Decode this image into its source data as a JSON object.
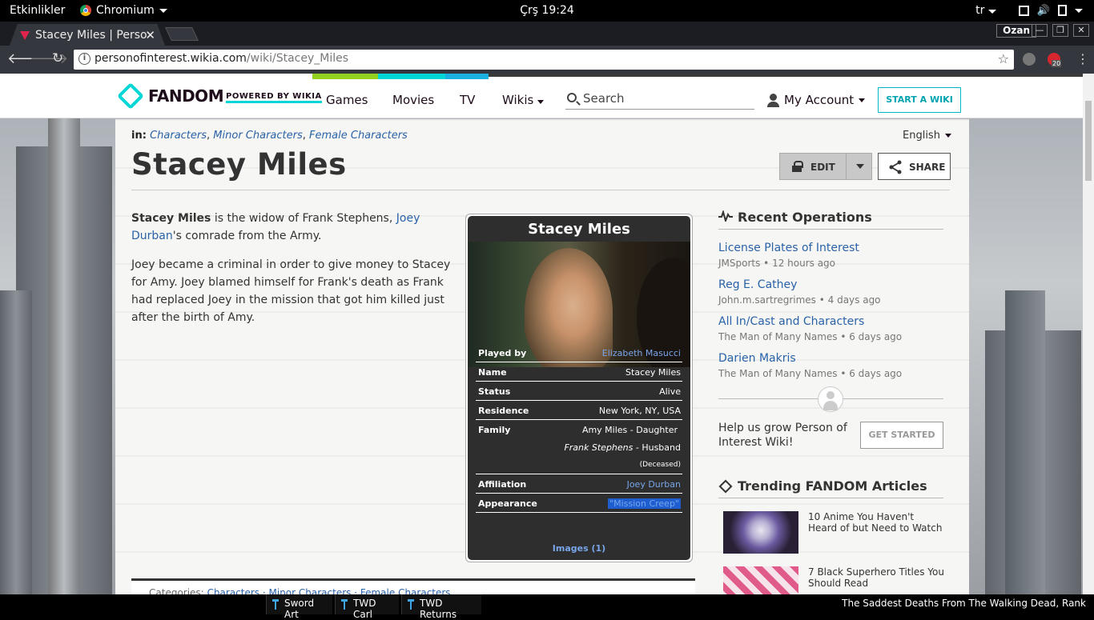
{
  "system": {
    "activities": "Etkinlikler",
    "app_name": "Chromium",
    "clock": "Çrş 19:24",
    "keyboard_layout": "tr",
    "accent_color": "#ffffff"
  },
  "browser": {
    "tab_title": "Stacey Miles | Perso",
    "user_badge": "Ozan",
    "url_domain": "personofinterest.wikia.com",
    "url_path": "/wiki/Stacey_Miles",
    "extension_badge": "20"
  },
  "fandom": {
    "logo_text": "FANDOM",
    "powered_by": "POWERED BY WIKIA",
    "nav": [
      "Games",
      "Movies",
      "TV",
      "Wikis"
    ],
    "search_placeholder": "Search",
    "account_label": "My Account",
    "start_wiki": "START A WIKI",
    "brand_color": "#00d6d6"
  },
  "article": {
    "in_label": "in:",
    "categories": [
      "Characters",
      "Minor Characters",
      "Female Characters"
    ],
    "language": "English",
    "title": "Stacey Miles",
    "edit_label": "EDIT",
    "share_label": "SHARE",
    "p1_bold": "Stacey Miles",
    "p1_text_a": " is the widow of Frank Stephens, ",
    "p1_link": "Joey Durban",
    "p1_text_b": "'s comrade from the Army.",
    "p2": "Joey became a criminal in order to give money to Stacey for Amy. Joey blamed himself for Frank's death as Frank had replaced Joey in the mission that got him killed just after the birth of Amy.",
    "categories_bar_label": "Categories:",
    "categories_bar_items": [
      "Characters",
      "Minor Characters",
      "Female Characters"
    ]
  },
  "infobox": {
    "title": "Stacey Miles",
    "rows": [
      {
        "key": "Played by",
        "value": "Elizabeth Masucci"
      },
      {
        "key": "Name",
        "value": "Stacey Miles"
      },
      {
        "key": "Status",
        "value": "Alive"
      },
      {
        "key": "Residence",
        "value": "New York, NY, USA"
      },
      {
        "key": "Family",
        "value": "Amy Miles - Daughter"
      },
      {
        "key": "Affiliation",
        "value": "Joey Durban"
      },
      {
        "key": "Appearance",
        "value": "\"Mission Creep\""
      }
    ],
    "family_line2_name": "Frank Stephens",
    "family_line2_rel": " - Husband",
    "family_line3": "(Deceased)",
    "images_link": "Images (1)"
  },
  "rail": {
    "recent_title": "Recent Operations",
    "recent": [
      {
        "title": "License Plates of Interest",
        "meta": "JMSports • 12 hours ago"
      },
      {
        "title": "Reg E. Cathey",
        "meta": "John.m.sartregrimes • 4 days ago"
      },
      {
        "title": "All In/Cast and Characters",
        "meta": "The Man of Many Names • 6 days ago"
      },
      {
        "title": "Darien Makris",
        "meta": "The Man of Many Names • 6 days ago"
      }
    ],
    "grow_text": "Help us grow Person of Interest Wiki!",
    "get_started": "GET STARTED",
    "trending_title": "Trending FANDOM Articles",
    "trending": [
      {
        "title": "10 Anime You Haven't Heard of but Need to Watch"
      },
      {
        "title": "7 Black Superhero Titles You Should Read"
      }
    ]
  },
  "taskbar": {
    "items": [
      "Sword Art",
      "TWD Carl",
      "TWD Returns"
    ],
    "ticker": "The Saddest Deaths From The Walking Dead, Rank"
  }
}
